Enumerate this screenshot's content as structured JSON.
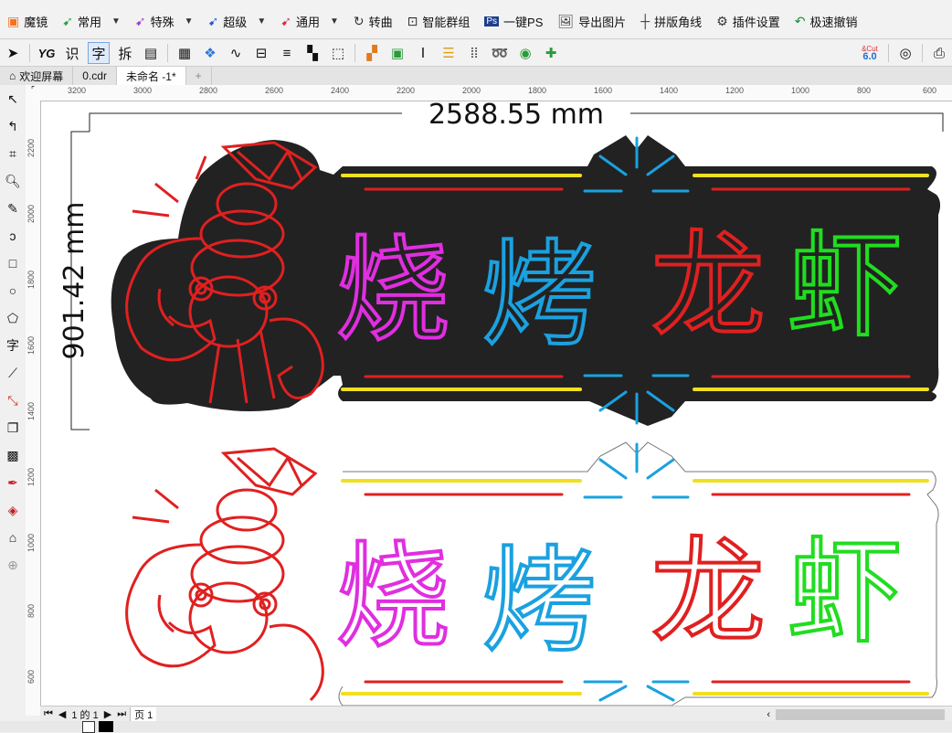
{
  "menu": {
    "items": [
      {
        "label": "魔镜",
        "icon": "magic-mirror-icon",
        "color": "#f5731f",
        "caret": false
      },
      {
        "label": "常用",
        "icon": "green-arrow-icon",
        "color": "#23a345",
        "caret": true
      },
      {
        "label": "特殊",
        "icon": "purple-arrow-icon",
        "color": "#9b3fd2",
        "caret": true
      },
      {
        "label": "超级",
        "icon": "blue-arrow-icon",
        "color": "#2555d1",
        "caret": true
      },
      {
        "label": "通用",
        "icon": "red-arrow-icon",
        "color": "#e0282e",
        "caret": true
      },
      {
        "label": "转曲",
        "icon": "curve-convert-icon",
        "color": "#333333",
        "caret": false
      },
      {
        "label": "智能群组",
        "icon": "smart-group-icon",
        "color": "#333333",
        "caret": false
      },
      {
        "label": "一键PS",
        "icon": "ps-icon",
        "color": "#1d3f8f",
        "caret": false
      },
      {
        "label": "导出图片",
        "icon": "export-image-icon",
        "color": "#333333",
        "caret": false
      },
      {
        "label": "拼版角线",
        "icon": "crop-marks-icon",
        "color": "#333333",
        "caret": false
      },
      {
        "label": "插件设置",
        "icon": "gear-icon",
        "color": "#333333",
        "caret": false
      },
      {
        "label": "极速撤销",
        "icon": "undo-icon",
        "color": "#1a8a3a",
        "caret": false
      }
    ]
  },
  "toolbar": {
    "yg": "YG",
    "char_shi": "识",
    "char_zi": "字",
    "char_chai": "拆",
    "version": "6.0",
    "cut_label": "&Cut"
  },
  "tabs": [
    {
      "label": "欢迎屏幕",
      "icon": "home-icon",
      "active": false
    },
    {
      "label": "0.cdr",
      "icon": "",
      "active": false
    },
    {
      "label": "未命名 -1*",
      "icon": "",
      "active": true
    }
  ],
  "ruler": {
    "h_ticks": [
      "3200",
      "3000",
      "2800",
      "2600",
      "2400",
      "2200",
      "2000",
      "1800",
      "1600",
      "1400",
      "1200",
      "1000",
      "800",
      "600"
    ],
    "v_ticks": [
      "2200",
      "2000",
      "1800",
      "1600",
      "1400",
      "1200",
      "1000",
      "800",
      "600"
    ]
  },
  "canvas": {
    "width_dim": "2588.55 mm",
    "height_dim": "901.42 mm",
    "sign_text": [
      "烧",
      "烤",
      "龙",
      "虾"
    ],
    "sign_colors": [
      "#e02ee0",
      "#1aa1e0",
      "#e02020",
      "#20dd20"
    ],
    "bg_color": "#222222"
  },
  "pagebar": {
    "page_count": "1 的 1",
    "page_tab": "页 1"
  }
}
